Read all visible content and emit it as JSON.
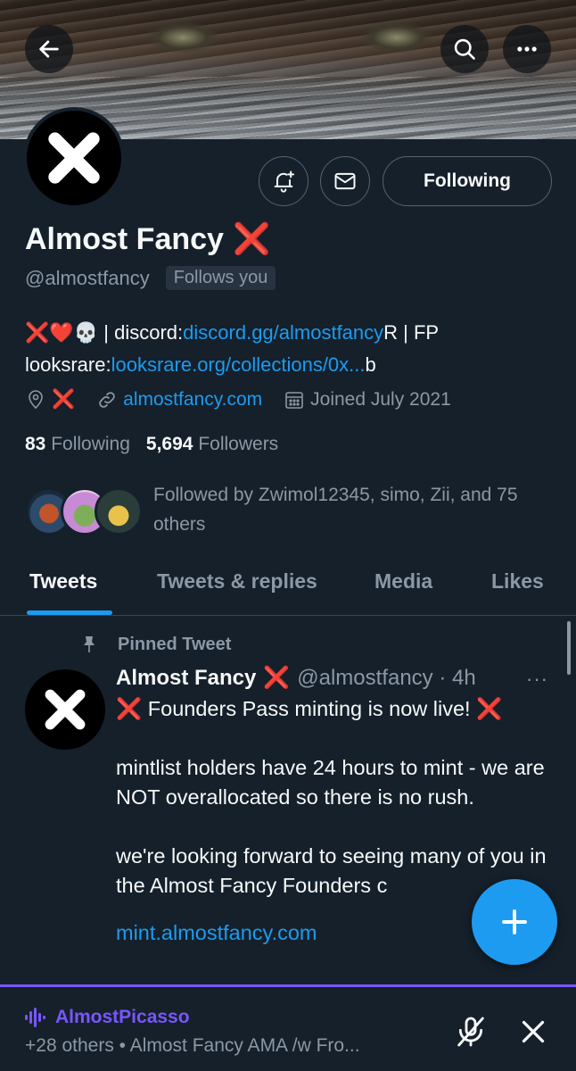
{
  "header": {
    "back_icon": "arrow-left-icon",
    "search_icon": "search-icon",
    "more_icon": "more-horizontal-icon"
  },
  "profile": {
    "name": "Almost Fancy",
    "name_emoji": "❌",
    "handle": "@almostfancy",
    "follows_you": "Follows you",
    "following_button": "Following",
    "bio_prefix": "❌❤️💀 | discord:",
    "bio_link1": "discord.gg/almostfancy",
    "bio_mid": "R | FP looksrare:",
    "bio_link2": "looksrare.org/collections/0x...",
    "bio_suffix": "b",
    "location": "❌",
    "website": "almostfancy.com",
    "joined": "Joined July 2021",
    "following_count": "83",
    "following_label": "Following",
    "followers_count": "5,694",
    "followers_label": "Followers",
    "followed_by": "Followed by Zwimol12345, simo, Zii, and 75 others"
  },
  "tabs": [
    {
      "label": "Tweets",
      "active": true
    },
    {
      "label": "Tweets & replies",
      "active": false
    },
    {
      "label": "Media",
      "active": false
    },
    {
      "label": "Likes",
      "active": false
    }
  ],
  "tweet": {
    "pinned_label": "Pinned Tweet",
    "author_name": "Almost Fancy",
    "author_emoji": "❌",
    "author_handle": "@almostfancy · 4h",
    "more": "···",
    "line1": "❌ Founders Pass minting is now live! ❌",
    "para2": "mintlist holders have 24 hours to mint - we are NOT overallocated so there is no rush.",
    "para3": "we're looking forward to seeing many of you in the Almost Fancy Founders c",
    "link": "mint.almostfancy.com"
  },
  "spaces": {
    "host": "AlmostPicasso",
    "subtitle": "+28 others • Almost Fancy AMA /w Fro..."
  },
  "colors": {
    "background": "#15202b",
    "accent": "#1d9bf0",
    "spaces": "#7856ff",
    "muted": "#8b98a5"
  }
}
